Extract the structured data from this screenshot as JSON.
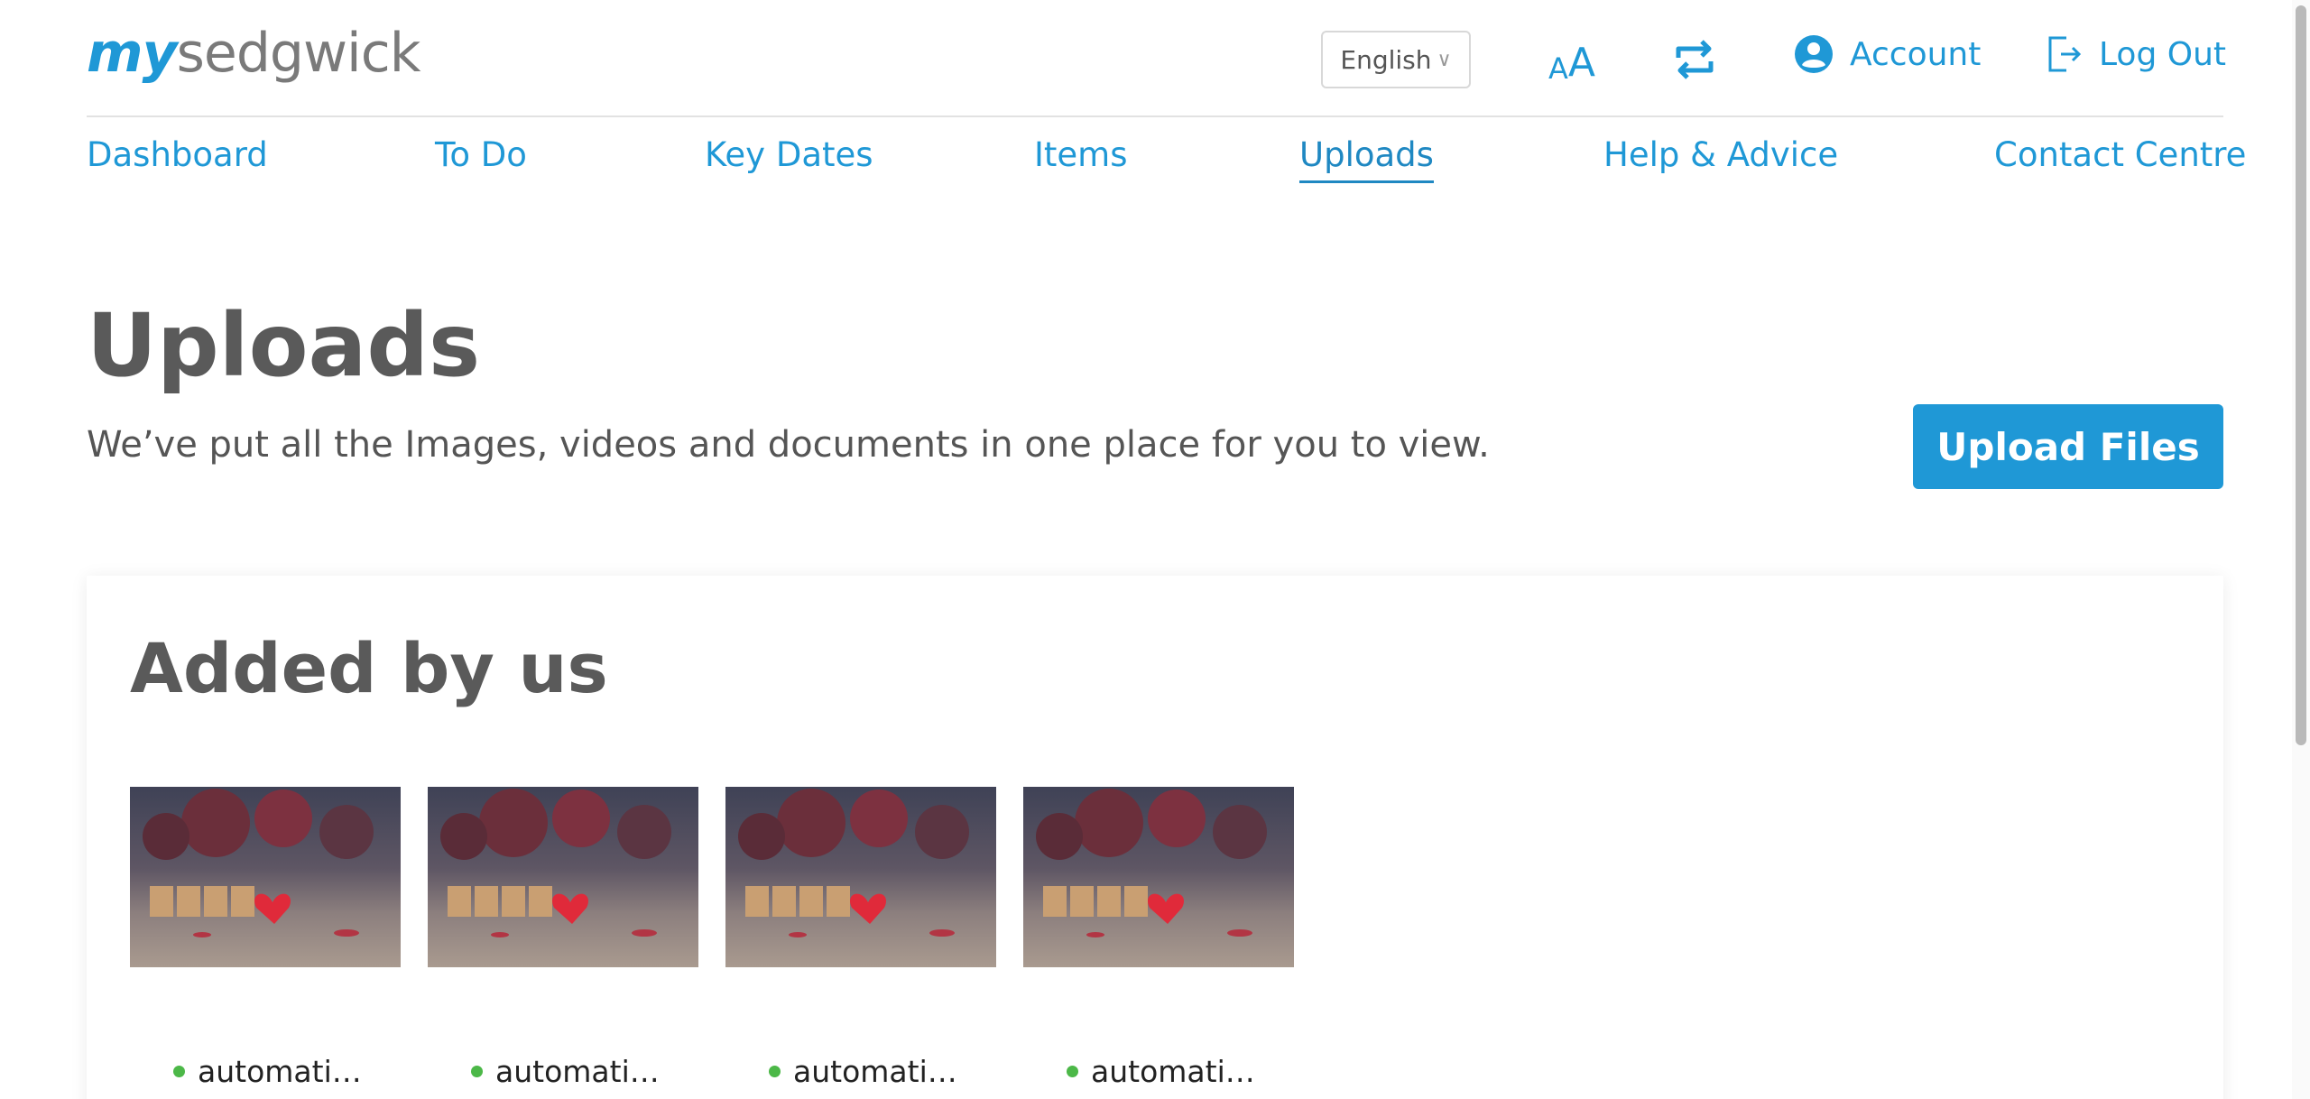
{
  "header": {
    "logo_prefix": "my",
    "logo_brand": "sedgwick",
    "language": "English",
    "text_size_small": "A",
    "text_size_large": "A",
    "account_label": "Account",
    "logout_label": "Log Out"
  },
  "nav": {
    "items": [
      {
        "label": "Dashboard"
      },
      {
        "label": "To Do"
      },
      {
        "label": "Key Dates"
      },
      {
        "label": "Items"
      },
      {
        "label": "Uploads",
        "active": true
      },
      {
        "label": "Help & Advice"
      },
      {
        "label": "Contact Centre"
      }
    ]
  },
  "main": {
    "title": "Uploads",
    "subtitle": "We’ve put all the Images, videos and documents in one place for you to view.",
    "upload_button": "Upload Files"
  },
  "section": {
    "title": "Added by us",
    "files": [
      {
        "name": "automati…",
        "status_color": "#4cb848"
      },
      {
        "name": "automati…",
        "status_color": "#4cb848"
      },
      {
        "name": "automati…",
        "status_color": "#4cb848"
      },
      {
        "name": "automati…",
        "status_color": "#4cb848"
      }
    ]
  },
  "colors": {
    "accent": "#1f98d6",
    "title_text": "#5a5a5a",
    "status_ok": "#4cb848"
  }
}
